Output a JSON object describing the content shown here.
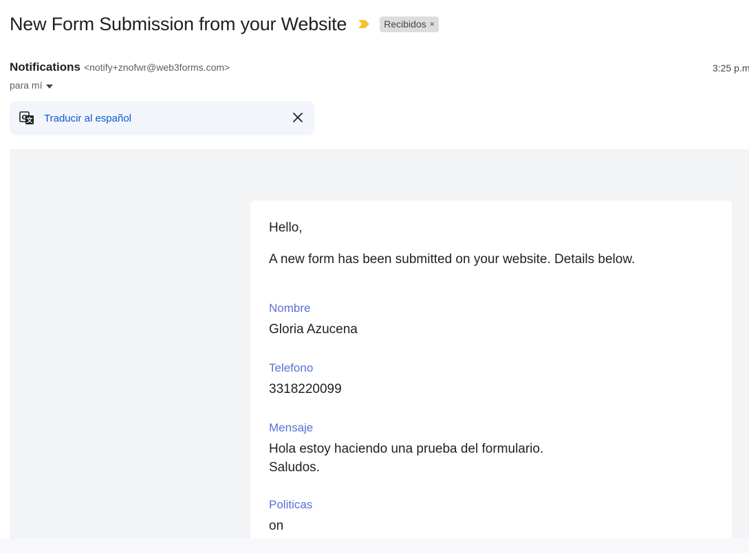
{
  "email": {
    "subject": "New Form Submission from your Website",
    "label": "Recibidos",
    "label_remove": "×",
    "sender_name": "Notifications",
    "sender_email": "<notify+znofwr@web3forms.com>",
    "time": "3:25 p.m",
    "to": "para mí"
  },
  "translate": {
    "link": "Traducir al español"
  },
  "body": {
    "greeting": "Hello,",
    "intro": "A new form has been submitted on your website. Details below.",
    "fields": [
      {
        "label": "Nombre",
        "value": "Gloria Azucena"
      },
      {
        "label": "Telefono",
        "value": "3318220099"
      },
      {
        "label": "Mensaje",
        "value_lines": [
          "Hola estoy haciendo una prueba del formulario.",
          "Saludos."
        ]
      },
      {
        "label": "Politicas",
        "value": "on"
      }
    ]
  },
  "colors": {
    "importance": "#f4c430",
    "link": "#0b57d0",
    "field_label": "#5a6fd6",
    "body_background": "#f3f4f6"
  }
}
